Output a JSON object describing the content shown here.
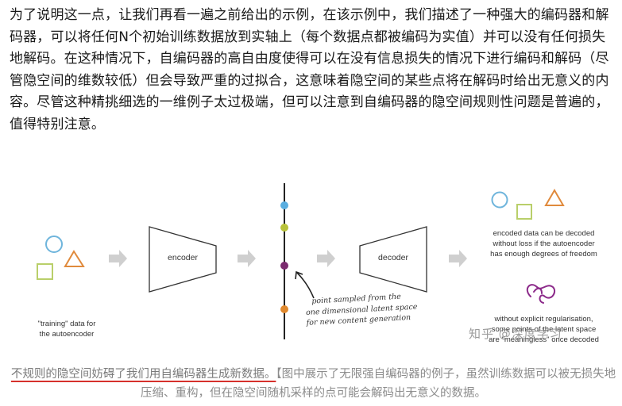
{
  "paragraph": {
    "text": "为了说明这一点，让我们再看一遍之前给出的示例，在该示例中，我们描述了一种强大的编码器和解码器，可以将任何N个初始训练数据放到实轴上（每个数据点都被编码为实值）并可以没有任何损失地解码。在这种情况下，自编码器的高自由度使得可以在没有信息损失的情况下进行编码和解码（尽管隐空间的维数较低）但会导致严重的过拟合，这意味着隐空间的某些点将在解码时给出无意义的内容。尽管这种精挑细选的一维例子太过极端，但可以注意到自编码器的隐空间规则性问题是普遍的，值得特别注意。"
  },
  "figure": {
    "training_label_1": "\"training\" data for",
    "training_label_2": "the autoencoder",
    "encoder_label": "encoder",
    "decoder_label": "decoder",
    "note_line_1": "point sampled from the",
    "note_line_2": "one dimensional latent space",
    "note_line_3": "for new content generation",
    "right_top_1": "encoded data can be decoded",
    "right_top_2": "without loss if the autoencoder",
    "right_top_3": "has enough degrees of freedom",
    "right_bottom_1": "without explicit regularisation,",
    "right_bottom_2": "some points of the latent space",
    "right_bottom_3": "are \"meaningless\" once decoded",
    "watermark": "知乎 @深度学习",
    "colors": {
      "circle": "#6fb5dc",
      "triangle": "#e08a3c",
      "square": "#b9cf6a",
      "arrow": "#cfcfcf",
      "point_blue": "#5aaee0",
      "point_olive": "#b8c23a",
      "point_purple": "#7a2a6e",
      "point_orange": "#e0892e",
      "garbled": "#8c2a8a"
    }
  },
  "caption": {
    "lead": "不规则的隐空间妨碍了我们用自编码器生成新数据。",
    "rest": "【图中展示了无限强自编码器的例子，虽然训练数据可以被无损失地压缩、重构，但在隐空间随机采样的点可能会解码出无意义的数据。"
  }
}
